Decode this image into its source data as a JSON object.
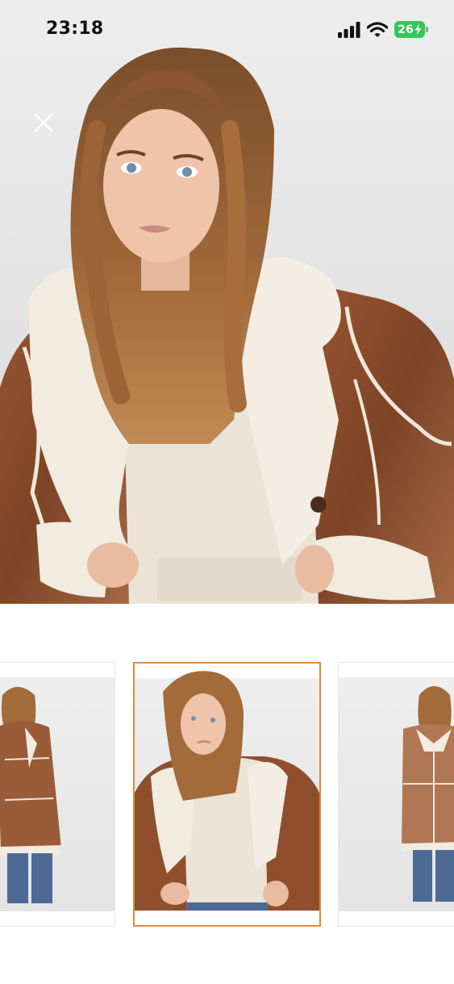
{
  "status_bar": {
    "time": "23:18",
    "battery_level": "26",
    "icons": [
      "signal-icon",
      "wifi-icon",
      "battery-charging-icon"
    ]
  },
  "viewer": {
    "close_icon": "close-icon",
    "main_image": "woman-in-cropped-brown-shearling-jacket",
    "selected_thumbnail_index": 1
  },
  "thumbnails": [
    {
      "subject": "long-brown-shearling-coat-side-view"
    },
    {
      "subject": "cropped-brown-shearling-jacket-front"
    },
    {
      "subject": "long-brown-shearling-coat-front-view"
    }
  ],
  "colors": {
    "selected_border": "#e3893c",
    "leather_brown": "#8a4b2a",
    "shearling_cream": "#efe7da",
    "battery_green": "#34c759"
  }
}
